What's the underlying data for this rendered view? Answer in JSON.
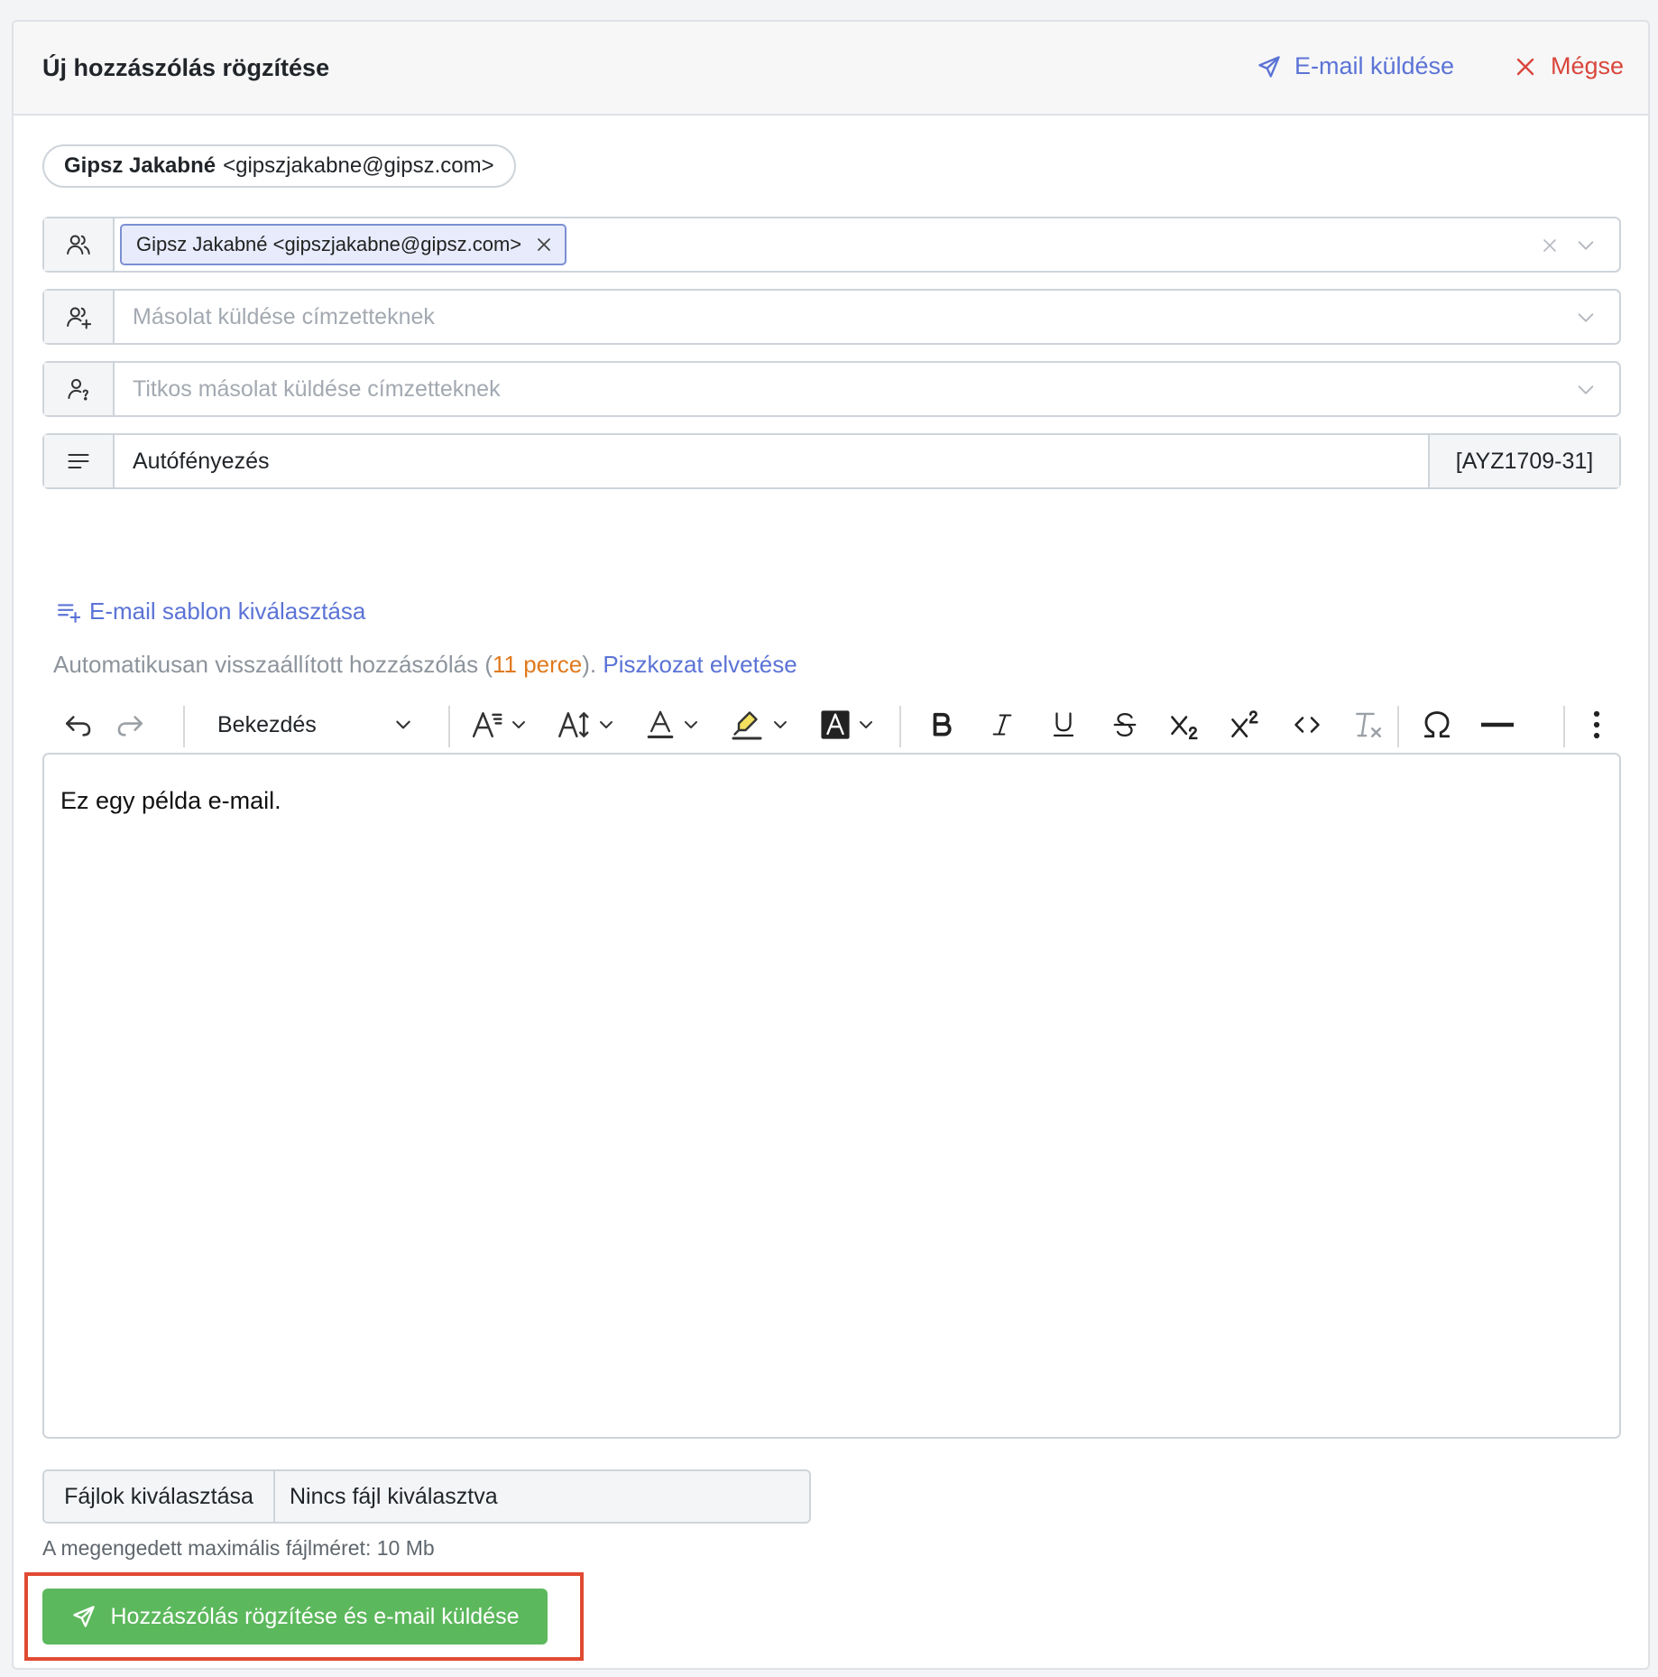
{
  "header": {
    "title": "Új hozzászólás rögzítése",
    "send_email_label": "E-mail küldése",
    "cancel_label": "Mégse"
  },
  "sender": {
    "name": "Gipsz Jakabné",
    "email": "<gipszjakabne@gipsz.com>"
  },
  "to": {
    "tags": [
      "Gipsz Jakabné <gipszjakabne@gipsz.com>"
    ]
  },
  "cc": {
    "placeholder": "Másolat küldése címzetteknek"
  },
  "bcc": {
    "placeholder": "Titkos másolat küldése címzetteknek"
  },
  "subject": {
    "value": "Autófényezés",
    "suffix": "[AYZ1709-31]"
  },
  "template_link": "E-mail sablon kiválasztása",
  "restore": {
    "prefix": "Automatikusan visszaállított hozzászólás (",
    "age": "11 perce",
    "suffix": ").",
    "discard_label": "Piszkozat elvetése"
  },
  "toolbar": {
    "block_format": "Bekezdés",
    "icons": [
      "undo-icon",
      "redo-icon",
      "font-family-icon",
      "font-size-icon",
      "font-color-icon",
      "highlight-icon",
      "background-color-icon",
      "bold-icon",
      "italic-icon",
      "underline-icon",
      "strikethrough-icon",
      "subscript-icon",
      "superscript-icon",
      "code-icon",
      "remove-format-icon",
      "special-characters-icon",
      "horizontal-line-icon",
      "more-icon"
    ]
  },
  "editor": {
    "content": "Ez egy példa e-mail."
  },
  "file": {
    "button_label": "Fájlok kiválasztása",
    "status": "Nincs fájl kiválasztva",
    "hint": "A megengedett maximális fájlméret: 10 Mb"
  },
  "submit_label": "Hozzászólás rögzítése és e-mail küldése",
  "colors": {
    "accent": "#5b73d6",
    "danger": "#d9463b",
    "success": "#5cb85c",
    "warning": "#e07a1e",
    "highlight_frame": "#e04a32"
  }
}
